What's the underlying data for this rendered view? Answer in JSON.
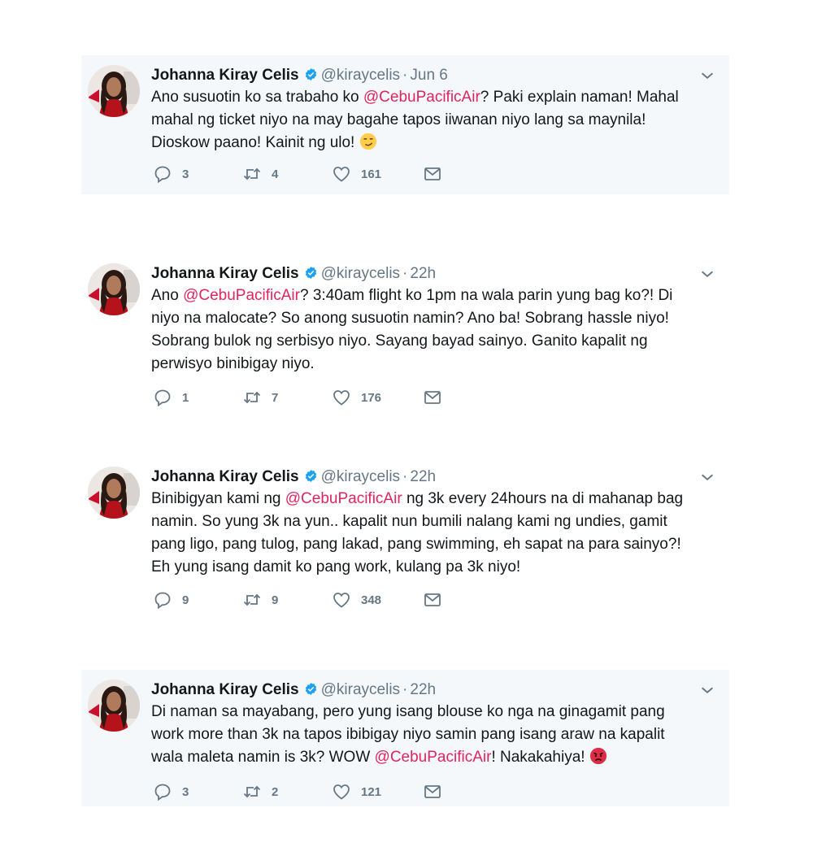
{
  "tweets": [
    {
      "name": "Johanna Kiray Celis",
      "handle": "@kiraycelis",
      "time": "Jun 6",
      "text_parts": [
        {
          "t": "Ano susuotin ko sa trabaho ko ",
          "m": false
        },
        {
          "t": "@CebuPacificAir",
          "m": true
        },
        {
          "t": "? Paki explain naman! Mahal mahal ng ticket niyo na may bagahe tapos iiwanan niyo lang sa maynila! Dioskow paano! Kainit ng ulo! ",
          "m": false
        }
      ],
      "emoji": "smirk-face-emoji",
      "replies": "3",
      "retweets": "4",
      "likes": "161"
    },
    {
      "name": "Johanna Kiray Celis",
      "handle": "@kiraycelis",
      "time": "22h",
      "text_parts": [
        {
          "t": "Ano ",
          "m": false
        },
        {
          "t": "@CebuPacificAir",
          "m": true
        },
        {
          "t": "? 3:40am flight ko 1pm na wala parin yung bag ko?! Di niyo na malocate? So anong susuotin namin? Ano ba! Sobrang hassle niyo! Sobrang bulok ng serbisyo niyo. Sayang bayad sainyo. Ganito kapalit ng perwisyo binibigay niyo.",
          "m": false
        }
      ],
      "emoji": "",
      "replies": "1",
      "retweets": "7",
      "likes": "176"
    },
    {
      "name": "Johanna Kiray Celis",
      "handle": "@kiraycelis",
      "time": "22h",
      "text_parts": [
        {
          "t": "Binibigyan kami ng ",
          "m": false
        },
        {
          "t": "@CebuPacificAir",
          "m": true
        },
        {
          "t": " ng 3k every 24hours na di mahanap bag namin. So yung 3k na yun.. kapalit nun bumili nalang kami ng undies, gamit pang ligo, pang tulog, pang lakad, pang swimming, eh sapat na para sainyo?! Eh yung isang damit ko pang work, kulang pa 3k niyo!",
          "m": false
        }
      ],
      "emoji": "",
      "replies": "9",
      "retweets": "9",
      "likes": "348"
    },
    {
      "name": "Johanna Kiray Celis",
      "handle": "@kiraycelis",
      "time": "22h",
      "text_parts": [
        {
          "t": "Di naman sa mayabang, pero yung isang blouse ko nga na ginagamit pang work more than 3k na tapos ibibigay niyo samin pang isang araw na kapalit wala maleta namin is 3k? WOW ",
          "m": false
        },
        {
          "t": "@CebuPacificAir",
          "m": true
        },
        {
          "t": "! Nakakahiya! ",
          "m": false
        }
      ],
      "emoji": "angry-face-emoji",
      "replies": "3",
      "retweets": "2",
      "likes": "121"
    }
  ],
  "dot": "·",
  "colors": {
    "mention": "#e0245e",
    "meta": "#657786",
    "verified": "#1da1f2",
    "card_bg": "#f5f8fa"
  }
}
